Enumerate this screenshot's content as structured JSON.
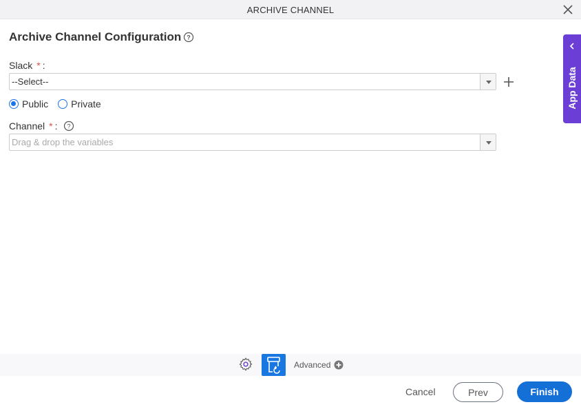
{
  "window": {
    "title": "ARCHIVE CHANNEL"
  },
  "form": {
    "heading": "Archive Channel Configuration",
    "slack": {
      "label": "Slack",
      "required_mark": "*",
      "colon": ":",
      "value": "--Select--"
    },
    "visibility": {
      "options": [
        {
          "label": "Public",
          "selected": true
        },
        {
          "label": "Private",
          "selected": false
        }
      ]
    },
    "channel": {
      "label": "Channel",
      "required_mark": "*",
      "colon": ":",
      "placeholder": "Drag & drop the variables"
    }
  },
  "side_panel": {
    "label": "App Data"
  },
  "toolbar": {
    "advanced_label": "Advanced"
  },
  "actions": {
    "cancel": "Cancel",
    "prev": "Prev",
    "finish": "Finish"
  },
  "colors": {
    "accent": "#1470d6",
    "panel": "#6b3fd6",
    "required": "#d9534f"
  }
}
